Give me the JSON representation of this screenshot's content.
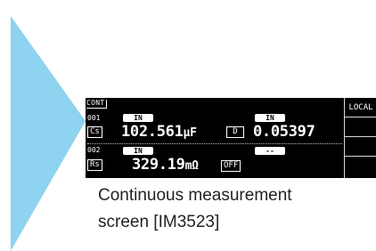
{
  "screen": {
    "mode_tag": "CONT",
    "side_buttons": [
      "LOCAL",
      "",
      "",
      ""
    ],
    "channels": [
      {
        "number": "001",
        "judge_primary": "IN",
        "judge_secondary": "IN",
        "primary_param": "Cs",
        "primary_value": "102.561",
        "primary_unit": "μF",
        "secondary_param": "D",
        "secondary_value": "0.05397"
      },
      {
        "number": "002",
        "judge_primary": "IN",
        "judge_secondary": "--",
        "primary_param": "Rs",
        "primary_value": "329.19",
        "primary_unit": "mΩ",
        "secondary_param": "OFF"
      }
    ]
  },
  "caption": {
    "line1": "Continuous measurement",
    "line2": "screen [IM3523]"
  },
  "colors": {
    "pointer": "#8ed3f0",
    "screen_bg": "#000000"
  }
}
